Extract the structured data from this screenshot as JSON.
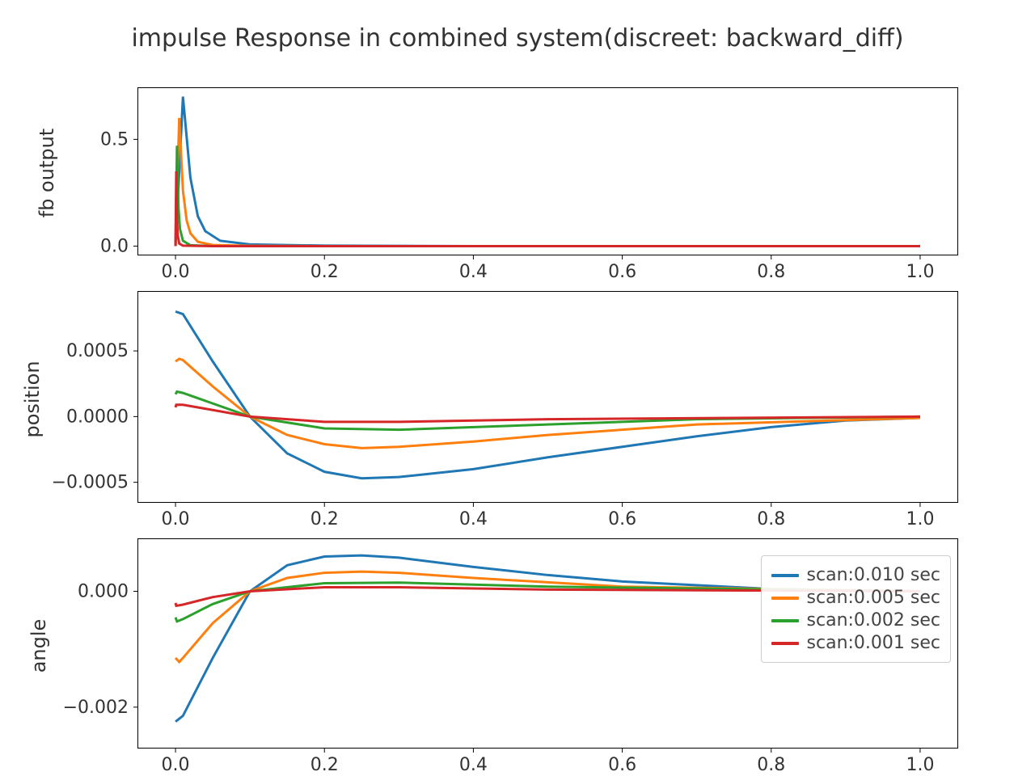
{
  "title": "impulse  Response in combined system(discreet: backward_diff)",
  "colors": {
    "s0": "#1f77b4",
    "s1": "#ff7f0e",
    "s2": "#2ca02c",
    "s3": "#d62728"
  },
  "legend": {
    "items": [
      {
        "label": "scan:0.010 sec",
        "colorKey": "s0"
      },
      {
        "label": "scan:0.005 sec",
        "colorKey": "s1"
      },
      {
        "label": "scan:0.002 sec",
        "colorKey": "s2"
      },
      {
        "label": "scan:0.001 sec",
        "colorKey": "s3"
      }
    ]
  },
  "panels": [
    {
      "id": "fb",
      "ylabel": "fb output",
      "xlim": [
        -0.05,
        1.05
      ],
      "ylim": [
        -0.04,
        0.74
      ],
      "xticks": [
        0.0,
        0.2,
        0.4,
        0.6,
        0.8,
        1.0
      ],
      "yticks": [
        0.0,
        0.5
      ]
    },
    {
      "id": "pos",
      "ylabel": "position",
      "xlim": [
        -0.05,
        1.05
      ],
      "ylim": [
        -0.00065,
        0.00095
      ],
      "xticks": [
        0.0,
        0.2,
        0.4,
        0.6,
        0.8,
        1.0
      ],
      "yticks": [
        -0.0005,
        0.0,
        0.0005
      ]
    },
    {
      "id": "ang",
      "ylabel": "angle",
      "xlim": [
        -0.05,
        1.05
      ],
      "ylim": [
        -0.0027,
        0.0009
      ],
      "xticks": [
        0.0,
        0.2,
        0.4,
        0.6,
        0.8,
        1.0
      ],
      "yticks": [
        -0.002,
        0.0
      ]
    }
  ],
  "chart_data": [
    {
      "type": "line",
      "id": "fb",
      "title": "",
      "xlabel": "",
      "ylabel": "fb output",
      "xlim": [
        -0.05,
        1.05
      ],
      "ylim": [
        -0.04,
        0.74
      ],
      "series": [
        {
          "name": "scan:0.010 sec",
          "colorKey": "s0",
          "x": [
            0.0,
            0.01,
            0.02,
            0.03,
            0.04,
            0.06,
            0.1,
            0.2,
            0.4,
            0.7,
            1.0
          ],
          "y": [
            0.0,
            0.7,
            0.32,
            0.14,
            0.07,
            0.025,
            0.008,
            0.002,
            0.0,
            0.0,
            0.0
          ]
        },
        {
          "name": "scan:0.005 sec",
          "colorKey": "s1",
          "x": [
            0.0,
            0.005,
            0.01,
            0.015,
            0.02,
            0.03,
            0.05,
            0.1,
            0.2,
            0.5,
            1.0
          ],
          "y": [
            0.0,
            0.6,
            0.26,
            0.12,
            0.06,
            0.02,
            0.005,
            0.001,
            0.0,
            0.0,
            0.0
          ]
        },
        {
          "name": "scan:0.002 sec",
          "colorKey": "s2",
          "x": [
            0.0,
            0.002,
            0.004,
            0.006,
            0.01,
            0.02,
            0.05,
            0.2,
            1.0
          ],
          "y": [
            0.0,
            0.47,
            0.18,
            0.08,
            0.025,
            0.004,
            0.0,
            0.0,
            0.0
          ]
        },
        {
          "name": "scan:0.001 sec",
          "colorKey": "s3",
          "x": [
            0.0,
            0.001,
            0.002,
            0.003,
            0.005,
            0.01,
            0.05,
            0.2,
            1.0
          ],
          "y": [
            0.0,
            0.35,
            0.12,
            0.05,
            0.012,
            0.002,
            0.0,
            0.0,
            0.0
          ]
        }
      ]
    },
    {
      "type": "line",
      "id": "pos",
      "title": "",
      "xlabel": "",
      "ylabel": "position",
      "xlim": [
        -0.05,
        1.05
      ],
      "ylim": [
        -0.00065,
        0.00095
      ],
      "series": [
        {
          "name": "scan:0.010 sec",
          "colorKey": "s0",
          "x": [
            0.0,
            0.01,
            0.05,
            0.1,
            0.15,
            0.2,
            0.25,
            0.3,
            0.4,
            0.5,
            0.6,
            0.7,
            0.8,
            0.9,
            1.0
          ],
          "y": [
            0.0008,
            0.00078,
            0.00042,
            0.0,
            -0.00028,
            -0.00042,
            -0.00047,
            -0.00046,
            -0.0004,
            -0.00031,
            -0.00023,
            -0.00015,
            -8e-05,
            -3e-05,
            -1e-05
          ]
        },
        {
          "name": "scan:0.005 sec",
          "colorKey": "s1",
          "x": [
            0.0,
            0.005,
            0.01,
            0.05,
            0.1,
            0.15,
            0.2,
            0.25,
            0.3,
            0.4,
            0.5,
            0.7,
            1.0
          ],
          "y": [
            0.00042,
            0.00044,
            0.00043,
            0.00023,
            0.0,
            -0.00014,
            -0.00021,
            -0.00024,
            -0.00023,
            -0.00019,
            -0.00014,
            -6e-05,
            -1e-05
          ]
        },
        {
          "name": "scan:0.002 sec",
          "colorKey": "s2",
          "x": [
            0.0,
            0.002,
            0.01,
            0.05,
            0.1,
            0.2,
            0.3,
            0.5,
            0.7,
            1.0
          ],
          "y": [
            0.00017,
            0.00019,
            0.00018,
            0.0001,
            0.0,
            -9e-05,
            -0.0001,
            -6e-05,
            -2e-05,
            0.0
          ]
        },
        {
          "name": "scan:0.001 sec",
          "colorKey": "s3",
          "x": [
            0.0,
            0.001,
            0.01,
            0.05,
            0.1,
            0.2,
            0.3,
            0.5,
            1.0
          ],
          "y": [
            7e-05,
            9e-05,
            9e-05,
            5e-05,
            0.0,
            -4e-05,
            -4e-05,
            -2e-05,
            0.0
          ]
        }
      ]
    },
    {
      "type": "line",
      "id": "ang",
      "title": "",
      "xlabel": "",
      "ylabel": "angle",
      "xlim": [
        -0.05,
        1.05
      ],
      "ylim": [
        -0.0027,
        0.0009
      ],
      "series": [
        {
          "name": "scan:0.010 sec",
          "colorKey": "s0",
          "x": [
            0.0,
            0.01,
            0.05,
            0.1,
            0.15,
            0.2,
            0.25,
            0.3,
            0.4,
            0.5,
            0.6,
            0.8,
            1.0
          ],
          "y": [
            -0.00225,
            -0.00215,
            -0.00115,
            0.0,
            0.00045,
            0.0006,
            0.00062,
            0.00058,
            0.00042,
            0.00028,
            0.00017,
            4e-05,
            0.0
          ]
        },
        {
          "name": "scan:0.005 sec",
          "colorKey": "s1",
          "x": [
            0.0,
            0.005,
            0.01,
            0.05,
            0.1,
            0.15,
            0.2,
            0.25,
            0.3,
            0.4,
            0.6,
            1.0
          ],
          "y": [
            -0.00115,
            -0.00122,
            -0.00115,
            -0.00055,
            0.0,
            0.00023,
            0.00032,
            0.00034,
            0.00032,
            0.00023,
            8e-05,
            0.0
          ]
        },
        {
          "name": "scan:0.002 sec",
          "colorKey": "s2",
          "x": [
            0.0,
            0.002,
            0.01,
            0.05,
            0.1,
            0.2,
            0.3,
            0.5,
            1.0
          ],
          "y": [
            -0.00045,
            -0.00052,
            -0.00048,
            -0.00022,
            0.0,
            0.00014,
            0.00015,
            8e-05,
            0.0
          ]
        },
        {
          "name": "scan:0.001 sec",
          "colorKey": "s3",
          "x": [
            0.0,
            0.001,
            0.01,
            0.05,
            0.1,
            0.2,
            0.3,
            0.5,
            1.0
          ],
          "y": [
            -0.0002,
            -0.00025,
            -0.00023,
            -0.0001,
            0.0,
            7e-05,
            7e-05,
            3e-05,
            0.0
          ]
        }
      ]
    }
  ]
}
